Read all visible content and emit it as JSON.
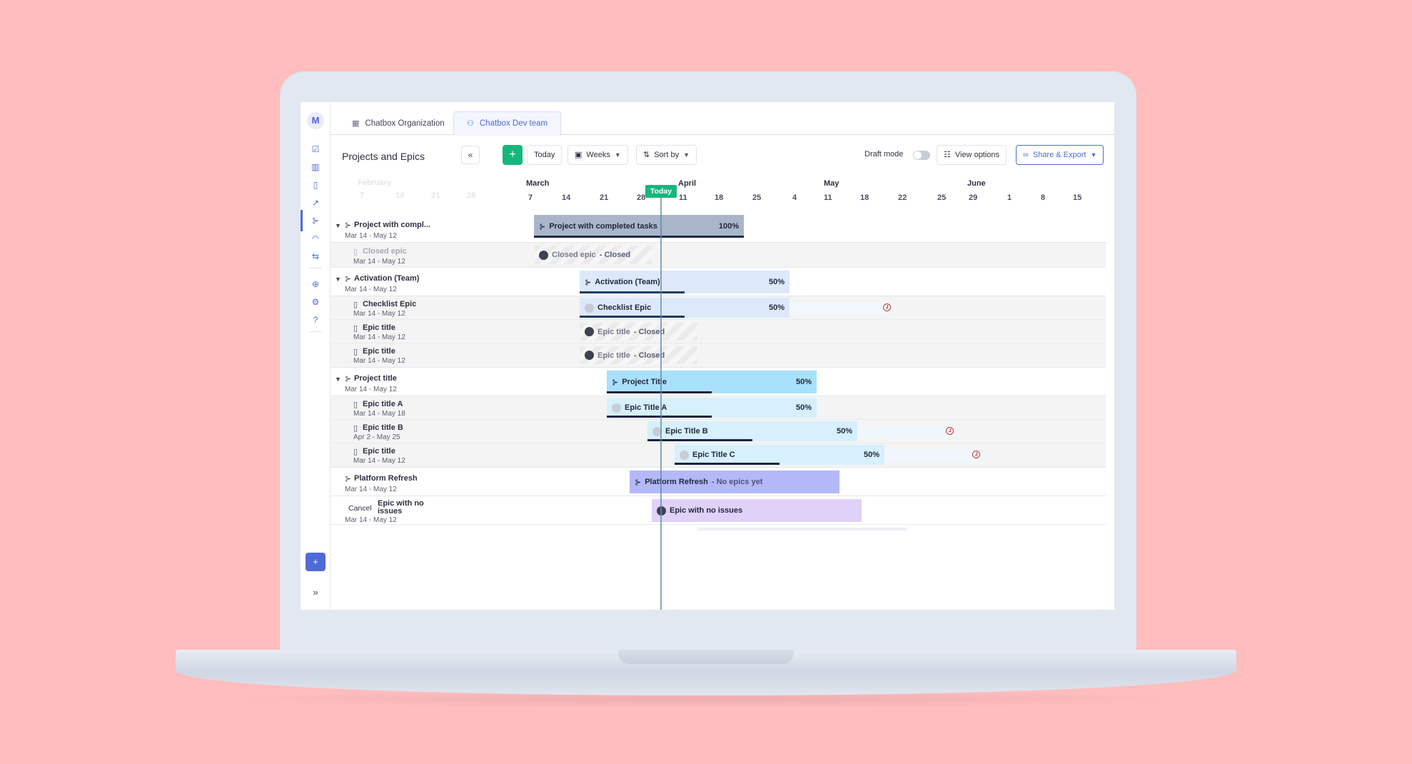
{
  "tabs": [
    {
      "label": "Chatbox Organization",
      "icon": "building-icon"
    },
    {
      "label": "Chatbox Dev team",
      "icon": "team-icon"
    }
  ],
  "sidebar": {
    "avatar_letter": "M"
  },
  "panel": {
    "title": "Projects and Epics",
    "collapse": "«"
  },
  "toolbar": {
    "add": "+",
    "today": "Today",
    "weeks": "Weeks",
    "sort": "Sort by",
    "draft_mode": "Draft mode",
    "view_options": "View options",
    "share_export": "Share & Export"
  },
  "timeline": {
    "ghost_month": "February",
    "ghost_days": [
      "7",
      "14",
      "21",
      "28"
    ],
    "months": [
      "March",
      "April",
      "May",
      "June"
    ],
    "days": [
      "7",
      "14",
      "21",
      "28",
      "11",
      "18",
      "25",
      "4",
      "11",
      "18",
      "22",
      "25",
      "29",
      "1",
      "8",
      "15"
    ],
    "today_label": "Today"
  },
  "rows": {
    "r1": {
      "title": "Project with compl...",
      "date": "Mar 14 - May 12",
      "bar": "Project with completed tasks",
      "pct": "100%"
    },
    "r2": {
      "title": "Closed epic",
      "date": "Mar 14 - May 12",
      "bar": "Closed epic",
      "status": "- Closed"
    },
    "r3": {
      "title": "Activation (Team)",
      "date": "Mar 14 - May 12",
      "bar": "Activation (Team)",
      "pct": "50%"
    },
    "r4": {
      "title": "Checklist Epic",
      "date": "Mar 14 - May 12",
      "bar": "Checklist Epic",
      "pct": "50%"
    },
    "r5": {
      "title": "Epic title",
      "date": "Mar 14 - May 12",
      "bar": "Epic title",
      "status": "- Closed"
    },
    "r6": {
      "title": "Epic title",
      "date": "Mar 14 - May 12",
      "bar": "Epic title",
      "status": "- Closed"
    },
    "r7": {
      "title": "Project title",
      "date": "Mar 14 - May 12",
      "bar": "Project Title",
      "pct": "50%"
    },
    "r8": {
      "title": "Epic title A",
      "date": "Mar 14 - May 18",
      "bar": "Epic Title A",
      "pct": "50%"
    },
    "r9": {
      "title": "Epic title B",
      "date": "Apr 2 - May 25",
      "bar": "Epic Title B",
      "pct": "50%"
    },
    "r10": {
      "title": "Epic title",
      "date": "Mar 14 - May 12",
      "bar": "Epic Title C",
      "pct": "50%"
    },
    "r11": {
      "title": "Platform Refresh",
      "date": "Mar 14 - May 12",
      "bar": "Platform Refresh",
      "status": "- No epics yet"
    },
    "r12": {
      "cancel": "Cancel",
      "title": "Epic with no issues",
      "date": "Mar 14 - May 12",
      "bar": "Epic with no issues"
    }
  },
  "progress": {
    "r1": 1.0,
    "r3": 0.5,
    "r4": 0.5,
    "r7": 0.5,
    "r8": 0.5,
    "r9": 0.5,
    "r10": 0.5
  },
  "colors": {
    "accent": "#4f6bd6",
    "add_button": "#16b77d",
    "today": "#16b77d",
    "overdue": "#c53b3b"
  }
}
